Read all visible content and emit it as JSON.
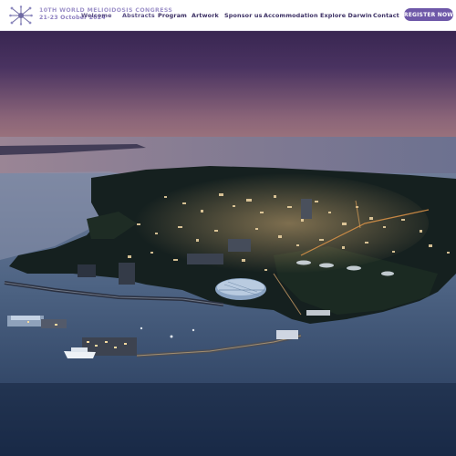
{
  "header": {
    "logo_icon": "starburst-network-logo-icon",
    "brand_title": "10TH WORLD MELIOIDOSIS CONGRESS",
    "brand_dates": "21-23 October 2024",
    "nav": [
      {
        "label": "Welcome"
      },
      {
        "label": "Abstracts"
      },
      {
        "label": "Program"
      },
      {
        "label": "Artwork"
      },
      {
        "label": "Sponsor us"
      },
      {
        "label": "Accommodation"
      },
      {
        "label": "Explore Darwin"
      },
      {
        "label": "Contact"
      }
    ],
    "register_label": "REGISTER NOW"
  },
  "colors": {
    "brand_purple": "#6e58a8",
    "nav_text": "#3b2f63",
    "header_bg": "#ffffff"
  },
  "hero": {
    "image_subject": "aerial-night-view-darwin-waterfront"
  }
}
